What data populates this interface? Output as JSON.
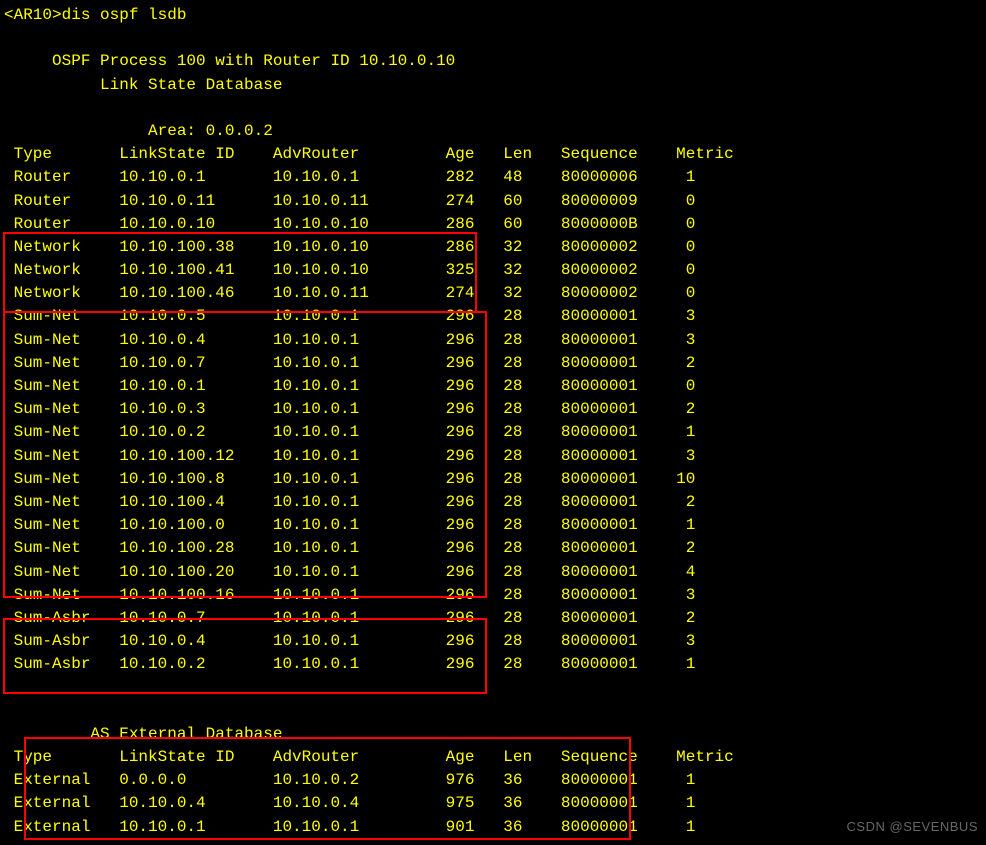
{
  "prompt": "<AR10>dis ospf lsdb",
  "header1": "     OSPF Process 100 with Router ID 10.10.0.10",
  "header2": "          Link State Database",
  "area_line": "               Area: 0.0.0.2",
  "cols": {
    "c1": "Type",
    "c2": "LinkState ID",
    "c3": "AdvRouter",
    "c4": "Age",
    "c5": "Len",
    "c6": "Sequence",
    "c7": "Metric"
  },
  "rows": [
    {
      "t": "Router",
      "ls": "10.10.0.1",
      "ar": "10.10.0.1",
      "age": "282",
      "len": "48",
      "seq": "80000006",
      "m": "1"
    },
    {
      "t": "Router",
      "ls": "10.10.0.11",
      "ar": "10.10.0.11",
      "age": "274",
      "len": "60",
      "seq": "80000009",
      "m": "0"
    },
    {
      "t": "Router",
      "ls": "10.10.0.10",
      "ar": "10.10.0.10",
      "age": "286",
      "len": "60",
      "seq": "8000000B",
      "m": "0"
    },
    {
      "t": "Network",
      "ls": "10.10.100.38",
      "ar": "10.10.0.10",
      "age": "286",
      "len": "32",
      "seq": "80000002",
      "m": "0"
    },
    {
      "t": "Network",
      "ls": "10.10.100.41",
      "ar": "10.10.0.10",
      "age": "325",
      "len": "32",
      "seq": "80000002",
      "m": "0"
    },
    {
      "t": "Network",
      "ls": "10.10.100.46",
      "ar": "10.10.0.11",
      "age": "274",
      "len": "32",
      "seq": "80000002",
      "m": "0"
    },
    {
      "t": "Sum-Net",
      "ls": "10.10.0.5",
      "ar": "10.10.0.1",
      "age": "296",
      "len": "28",
      "seq": "80000001",
      "m": "3"
    },
    {
      "t": "Sum-Net",
      "ls": "10.10.0.4",
      "ar": "10.10.0.1",
      "age": "296",
      "len": "28",
      "seq": "80000001",
      "m": "3"
    },
    {
      "t": "Sum-Net",
      "ls": "10.10.0.7",
      "ar": "10.10.0.1",
      "age": "296",
      "len": "28",
      "seq": "80000001",
      "m": "2"
    },
    {
      "t": "Sum-Net",
      "ls": "10.10.0.1",
      "ar": "10.10.0.1",
      "age": "296",
      "len": "28",
      "seq": "80000001",
      "m": "0"
    },
    {
      "t": "Sum-Net",
      "ls": "10.10.0.3",
      "ar": "10.10.0.1",
      "age": "296",
      "len": "28",
      "seq": "80000001",
      "m": "2"
    },
    {
      "t": "Sum-Net",
      "ls": "10.10.0.2",
      "ar": "10.10.0.1",
      "age": "296",
      "len": "28",
      "seq": "80000001",
      "m": "1"
    },
    {
      "t": "Sum-Net",
      "ls": "10.10.100.12",
      "ar": "10.10.0.1",
      "age": "296",
      "len": "28",
      "seq": "80000001",
      "m": "3"
    },
    {
      "t": "Sum-Net",
      "ls": "10.10.100.8",
      "ar": "10.10.0.1",
      "age": "296",
      "len": "28",
      "seq": "80000001",
      "m": "10"
    },
    {
      "t": "Sum-Net",
      "ls": "10.10.100.4",
      "ar": "10.10.0.1",
      "age": "296",
      "len": "28",
      "seq": "80000001",
      "m": "2"
    },
    {
      "t": "Sum-Net",
      "ls": "10.10.100.0",
      "ar": "10.10.0.1",
      "age": "296",
      "len": "28",
      "seq": "80000001",
      "m": "1"
    },
    {
      "t": "Sum-Net",
      "ls": "10.10.100.28",
      "ar": "10.10.0.1",
      "age": "296",
      "len": "28",
      "seq": "80000001",
      "m": "2"
    },
    {
      "t": "Sum-Net",
      "ls": "10.10.100.20",
      "ar": "10.10.0.1",
      "age": "296",
      "len": "28",
      "seq": "80000001",
      "m": "4"
    },
    {
      "t": "Sum-Net",
      "ls": "10.10.100.16",
      "ar": "10.10.0.1",
      "age": "296",
      "len": "28",
      "seq": "80000001",
      "m": "3"
    },
    {
      "t": "Sum-Asbr",
      "ls": "10.10.0.7",
      "ar": "10.10.0.1",
      "age": "296",
      "len": "28",
      "seq": "80000001",
      "m": "2"
    },
    {
      "t": "Sum-Asbr",
      "ls": "10.10.0.4",
      "ar": "10.10.0.1",
      "age": "296",
      "len": "28",
      "seq": "80000001",
      "m": "3"
    },
    {
      "t": "Sum-Asbr",
      "ls": "10.10.0.2",
      "ar": "10.10.0.1",
      "age": "296",
      "len": "28",
      "seq": "80000001",
      "m": "1"
    }
  ],
  "ext_header": "         AS External Database",
  "ext_rows": [
    {
      "t": "External",
      "ls": "0.0.0.0",
      "ar": "10.10.0.2",
      "age": "976",
      "len": "36",
      "seq": "80000001",
      "m": "1"
    },
    {
      "t": "External",
      "ls": "10.10.0.4",
      "ar": "10.10.0.4",
      "age": "975",
      "len": "36",
      "seq": "80000001",
      "m": "1"
    },
    {
      "t": "External",
      "ls": "10.10.0.1",
      "ar": "10.10.0.1",
      "age": "901",
      "len": "36",
      "seq": "80000001",
      "m": "1"
    }
  ],
  "watermark": "CSDN @SEVENBUS"
}
